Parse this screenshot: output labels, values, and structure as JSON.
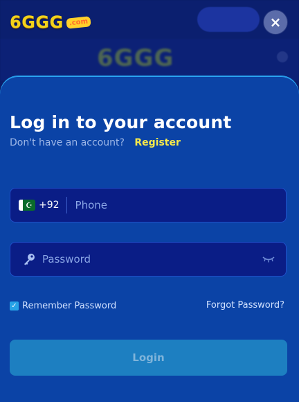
{
  "logo": {
    "brand": "6GGG",
    "dotcom": ".com"
  },
  "close": {
    "label": "×"
  },
  "login": {
    "title": "Log in to your account",
    "subtitle": "Don't have an account?",
    "register_label": "Register",
    "phone": {
      "country_code": "+92",
      "placeholder": "Phone",
      "flag": "Pakistan"
    },
    "password": {
      "placeholder": "Password"
    },
    "remember_label": "Remember Password",
    "remember_checked": true,
    "forgot_label": "Forgot Password?",
    "submit_label": "Login"
  },
  "colors": {
    "sheet": "#0b43a6",
    "field": "#0a1d86",
    "accent_yellow": "#f7e94a",
    "button": "#1d7fc1"
  },
  "icons": [
    "pakistan-flag-icon",
    "key-icon",
    "eye-closed-icon",
    "close-icon",
    "checkmark-icon"
  ]
}
